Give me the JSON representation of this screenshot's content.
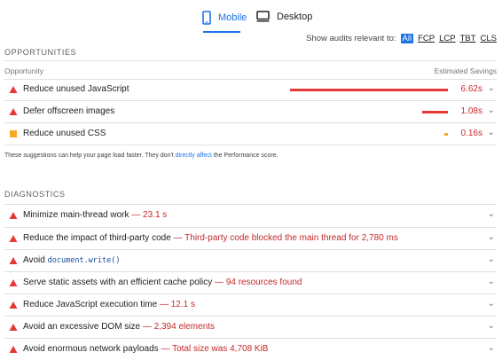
{
  "tabs": {
    "mobile": "Mobile",
    "desktop": "Desktop",
    "active": "mobile"
  },
  "filter": {
    "label": "Show audits relevant to:",
    "chips": [
      "All",
      "FCP",
      "LCP",
      "TBT",
      "CLS"
    ],
    "selected": "All"
  },
  "opportunities": {
    "title": "OPPORTUNITIES",
    "col_left": "Opportunity",
    "col_right": "Estimated Savings",
    "items": [
      {
        "label": "Reduce unused JavaScript",
        "savings": "6.62s",
        "savings_seconds": 6.62,
        "severity": "fail"
      },
      {
        "label": "Defer offscreen images",
        "savings": "1.08s",
        "savings_seconds": 1.08,
        "severity": "fail"
      },
      {
        "label": "Reduce unused CSS",
        "savings": "0.16s",
        "savings_seconds": 0.16,
        "severity": "average"
      }
    ],
    "hint_prefix": "These suggestions can help your page load faster. They don't ",
    "hint_link": "directly affect",
    "hint_suffix": " the Performance score."
  },
  "diagnostics": {
    "title": "DIAGNOSTICS",
    "items": [
      {
        "label": "Minimize main-thread work",
        "sep": " — ",
        "display": "23.1 s"
      },
      {
        "label": "Reduce the impact of third-party code",
        "sep": " — ",
        "display": "Third-party code blocked the main thread for 2,780 ms"
      },
      {
        "label": "Avoid ",
        "code": "document.write()"
      },
      {
        "label": "Serve static assets with an efficient cache policy",
        "sep": " — ",
        "display": "94 resources found"
      },
      {
        "label": "Reduce JavaScript execution time",
        "sep": " — ",
        "display": "12.1 s"
      },
      {
        "label": "Avoid an excessive DOM size",
        "sep": " — ",
        "display": "2,394 elements"
      },
      {
        "label": "Avoid enormous network payloads",
        "sep": " — ",
        "display": "Total size was 4,708 KiB"
      }
    ]
  },
  "colors": {
    "fail": "#e53935",
    "average": "#f9a825",
    "accent": "#1a73e8"
  },
  "icons": {
    "fail": "triangle-icon",
    "average": "square-icon",
    "expand": "chevron-down-icon"
  }
}
